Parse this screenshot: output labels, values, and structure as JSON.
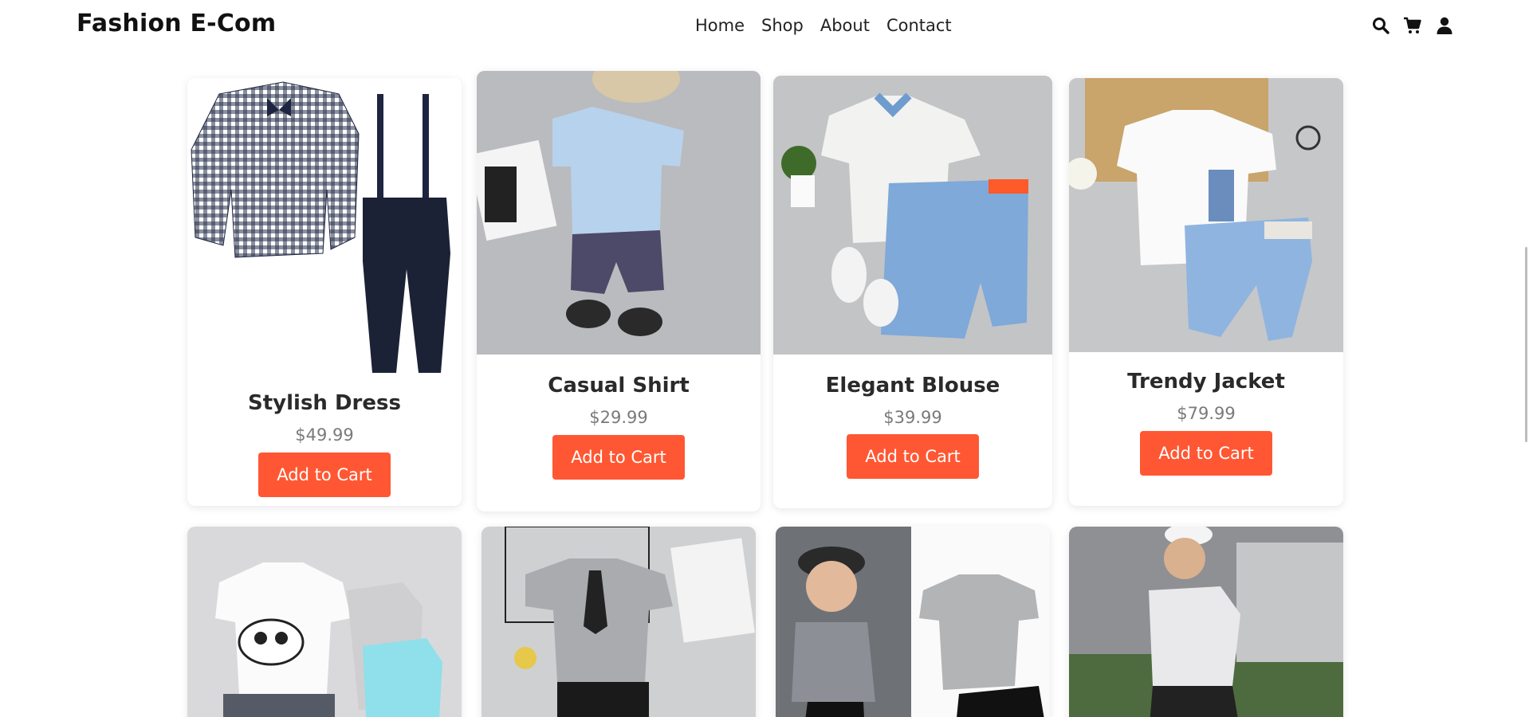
{
  "header": {
    "brand": "Fashion E-Com",
    "nav": [
      "Home",
      "Shop",
      "About",
      "Contact"
    ],
    "icons": [
      "search-icon",
      "cart-icon",
      "user-icon"
    ]
  },
  "products": [
    {
      "name": "Stylish Dress",
      "price": "$49.99",
      "button": "Add to Cart"
    },
    {
      "name": "Casual Shirt",
      "price": "$29.99",
      "button": "Add to Cart"
    },
    {
      "name": "Elegant Blouse",
      "price": "$39.99",
      "button": "Add to Cart"
    },
    {
      "name": "Trendy Jacket",
      "price": "$79.99",
      "button": "Add to Cart"
    }
  ],
  "colors": {
    "accent": "#ff5733",
    "text": "#2a2a2a",
    "price": "#7a7a7a"
  }
}
